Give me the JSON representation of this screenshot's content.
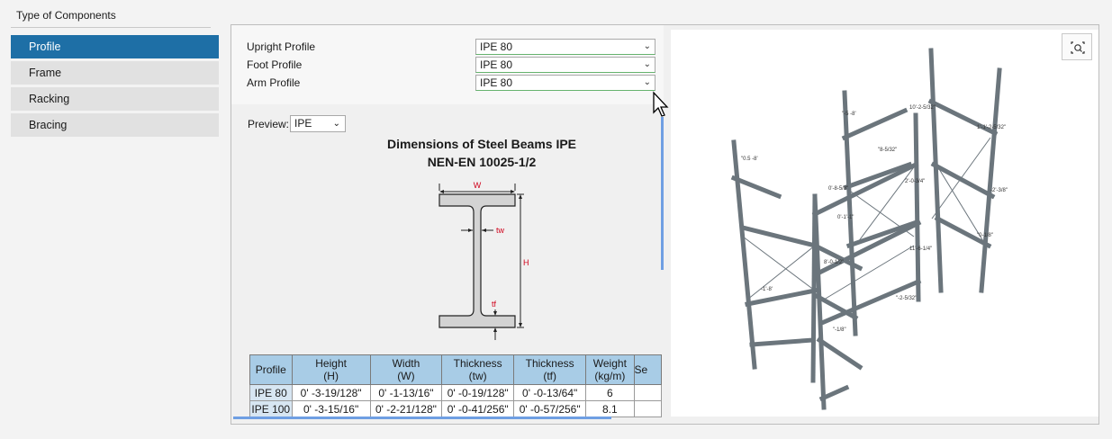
{
  "left_panel": {
    "title": "Type of Components",
    "items": [
      {
        "label": "Profile",
        "active": true
      },
      {
        "label": "Frame",
        "active": false
      },
      {
        "label": "Racking",
        "active": false
      },
      {
        "label": "Bracing",
        "active": false
      }
    ]
  },
  "properties": {
    "upright": {
      "label": "Upright Profile",
      "value": "IPE 80"
    },
    "foot": {
      "label": "Foot Profile",
      "value": "IPE 80"
    },
    "arm": {
      "label": "Arm Profile",
      "value": "IPE 80"
    }
  },
  "preview": {
    "label": "Preview:",
    "value": "IPE",
    "title_line1": "Dimensions of Steel Beams IPE",
    "title_line2": "NEN-EN 10025-1/2",
    "dim_w": "W",
    "dim_tw": "tw",
    "dim_h": "H",
    "dim_tf": "tf"
  },
  "table": {
    "headers": [
      {
        "l1": "Profile",
        "l2": ""
      },
      {
        "l1": "Height",
        "l2": "(H)"
      },
      {
        "l1": "Width",
        "l2": "(W)"
      },
      {
        "l1": "Thickness",
        "l2": "(tw)"
      },
      {
        "l1": "Thickness",
        "l2": "(tf)"
      },
      {
        "l1": "Weight",
        "l2": "(kg/m)"
      },
      {
        "l1": "Se",
        "l2": ""
      }
    ],
    "rows": [
      [
        "IPE 80",
        "0' -3-19/128\"",
        "0' -1-13/16\"",
        "0' -0-19/128\"",
        "0' -0-13/64\"",
        "6",
        ""
      ],
      [
        "IPE 100",
        "0' -3-15/16\"",
        "0' -2-21/128\"",
        "0' -0-41/256\"",
        "0' -0-57/256\"",
        "8.1",
        ""
      ]
    ]
  },
  "colors": {
    "accent": "#1e6fa6",
    "dim_red": "#d0021b",
    "beam_fill": "#d3d3d3",
    "steel": "#6b757c"
  },
  "icons": {
    "zoom": "zoom-fit-icon",
    "chevron": "chevron-down-icon",
    "cursor": "mouse-pointer-icon"
  }
}
